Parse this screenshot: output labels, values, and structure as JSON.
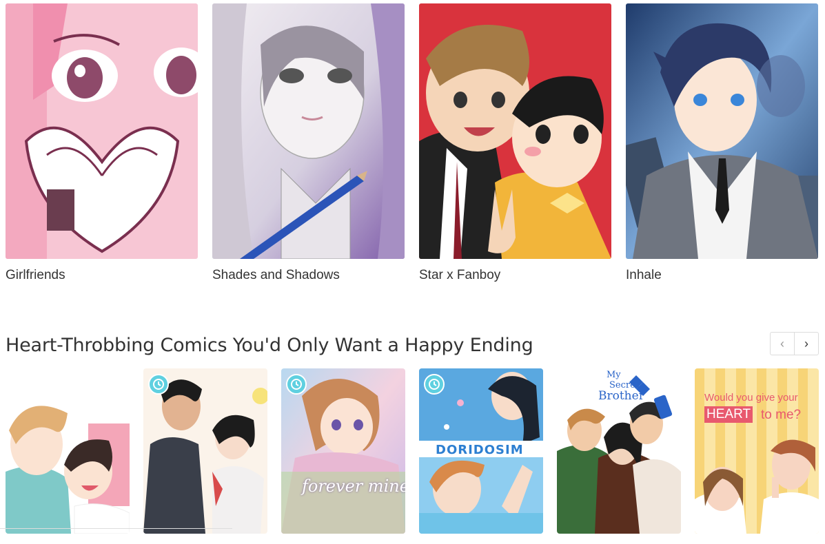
{
  "featured": {
    "cards": [
      {
        "title": "Girlfriends"
      },
      {
        "title": "Shades and Shadows"
      },
      {
        "title": "Star x Fanboy"
      },
      {
        "title": "Inhale"
      }
    ]
  },
  "section": {
    "title": "Heart-Throbbing Comics You'd Only Want a Happy Ending",
    "prev_label": "‹",
    "next_label": "›"
  },
  "comics": [
    {
      "cover_icon": "couple-illustration",
      "has_clock_badge": false
    },
    {
      "cover_icon": "couple-illustration",
      "has_clock_badge": true
    },
    {
      "cover_icon": "girl-illustration",
      "has_clock_badge": true,
      "cover_text": "forever mine"
    },
    {
      "cover_icon": "characters-illustration",
      "has_clock_badge": true,
      "cover_text": "DORIDOSIM"
    },
    {
      "cover_icon": "group-illustration",
      "has_clock_badge": false,
      "cover_text_lines": [
        "My",
        "Secret",
        "Brother"
      ]
    },
    {
      "cover_icon": "couple-illustration",
      "has_clock_badge": false,
      "cover_text_lines": [
        "Would you give your",
        "HEART",
        "to me?"
      ]
    }
  ],
  "colors": {
    "badge": "#5fd0e0",
    "text": "#333333",
    "border": "#dcdcdc"
  }
}
